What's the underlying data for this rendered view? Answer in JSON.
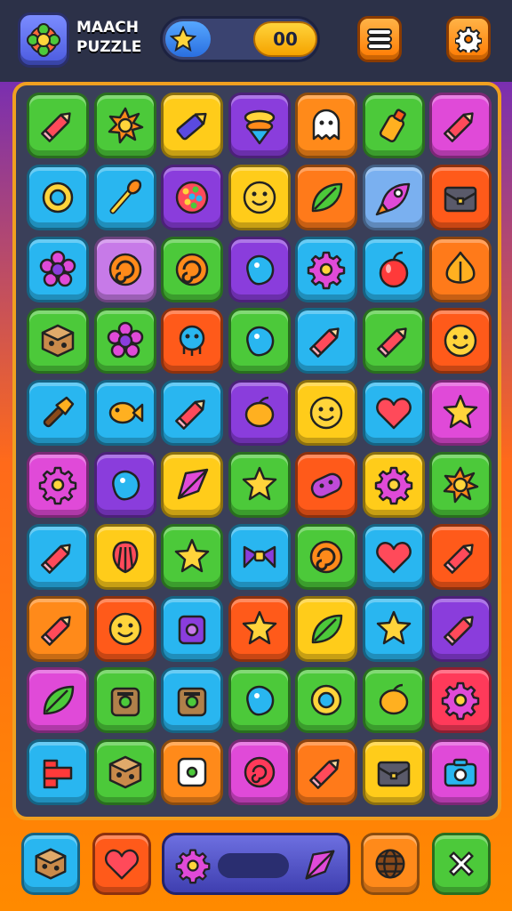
{
  "header": {
    "title_line1": "MAACH",
    "title_line2": "PUZZLE",
    "score": "00",
    "progress_fraction": 0.5
  },
  "board": {
    "columns": 7,
    "rows": 10,
    "tiles": [
      [
        {
          "color": "#4cc93a",
          "icon": "pencil-icon"
        },
        {
          "color": "#4cc93a",
          "icon": "sun-icon"
        },
        {
          "color": "#ffcc1a",
          "icon": "crayon-icon"
        },
        {
          "color": "#8a3ddc",
          "icon": "cone-icon"
        },
        {
          "color": "#ff8a1a",
          "icon": "ghost-icon"
        },
        {
          "color": "#4cc93a",
          "icon": "bottle-icon"
        },
        {
          "color": "#e04ad8",
          "icon": "pencil-icon"
        }
      ],
      [
        {
          "color": "#29b6f0",
          "icon": "ring-icon"
        },
        {
          "color": "#29b6f0",
          "icon": "wand-icon"
        },
        {
          "color": "#8a3ddc",
          "icon": "berry-icon"
        },
        {
          "color": "#ffcc1a",
          "icon": "smiley-icon"
        },
        {
          "color": "#ff7a1a",
          "icon": "leaf-icon"
        },
        {
          "color": "#7ab0f0",
          "icon": "rocket-icon"
        },
        {
          "color": "#ff5a1a",
          "icon": "chest-icon"
        }
      ],
      [
        {
          "color": "#29b6f0",
          "icon": "flower-icon"
        },
        {
          "color": "#c77ae8",
          "icon": "swirl-icon"
        },
        {
          "color": "#4cc93a",
          "icon": "swirl-icon"
        },
        {
          "color": "#8a3ddc",
          "icon": "blob-icon"
        },
        {
          "color": "#29b6f0",
          "icon": "gear-icon"
        },
        {
          "color": "#29b6f0",
          "icon": "cherry-icon"
        },
        {
          "color": "#ff7a1a",
          "icon": "onion-icon"
        }
      ],
      [
        {
          "color": "#4cc93a",
          "icon": "cube-icon"
        },
        {
          "color": "#4cc93a",
          "icon": "flower-icon"
        },
        {
          "color": "#ff5a1a",
          "icon": "critter-icon"
        },
        {
          "color": "#4cc93a",
          "icon": "blob-icon"
        },
        {
          "color": "#29b6f0",
          "icon": "pencil-icon"
        },
        {
          "color": "#4cc93a",
          "icon": "pencil-icon"
        },
        {
          "color": "#ff5a1a",
          "icon": "smiley-icon"
        }
      ],
      [
        {
          "color": "#29b6f0",
          "icon": "brush-icon"
        },
        {
          "color": "#29b6f0",
          "icon": "fish-icon"
        },
        {
          "color": "#29b6f0",
          "icon": "pencil-icon"
        },
        {
          "color": "#8a3ddc",
          "icon": "lemon-icon"
        },
        {
          "color": "#ffcc1a",
          "icon": "smiley-icon"
        },
        {
          "color": "#29b6f0",
          "icon": "heart-icon"
        },
        {
          "color": "#e04ad8",
          "icon": "star-icon"
        }
      ],
      [
        {
          "color": "#e04ad8",
          "icon": "gear-icon"
        },
        {
          "color": "#8a3ddc",
          "icon": "blob-icon"
        },
        {
          "color": "#ffcc1a",
          "icon": "kite-icon"
        },
        {
          "color": "#4cc93a",
          "icon": "star-icon"
        },
        {
          "color": "#ff5a1a",
          "icon": "capsule-icon"
        },
        {
          "color": "#ffcc1a",
          "icon": "gear-icon"
        },
        {
          "color": "#4cc93a",
          "icon": "sun-icon"
        }
      ],
      [
        {
          "color": "#29b6f0",
          "icon": "pencil-icon"
        },
        {
          "color": "#ffcc1a",
          "icon": "shell-icon"
        },
        {
          "color": "#4cc93a",
          "icon": "star-icon"
        },
        {
          "color": "#29b6f0",
          "icon": "bow-icon"
        },
        {
          "color": "#4cc93a",
          "icon": "swirl-icon"
        },
        {
          "color": "#29b6f0",
          "icon": "heart-icon"
        },
        {
          "color": "#ff5a1a",
          "icon": "pencil-icon"
        }
      ],
      [
        {
          "color": "#ff8a1a",
          "icon": "pencil-icon"
        },
        {
          "color": "#ff5a1a",
          "icon": "smiley-icon"
        },
        {
          "color": "#29b6f0",
          "icon": "box-icon"
        },
        {
          "color": "#ff5a1a",
          "icon": "star-icon"
        },
        {
          "color": "#ffcc1a",
          "icon": "leaf-icon"
        },
        {
          "color": "#29b6f0",
          "icon": "star-icon"
        },
        {
          "color": "#8a3ddc",
          "icon": "pencil-icon"
        }
      ],
      [
        {
          "color": "#e04ad8",
          "icon": "leaf-icon"
        },
        {
          "color": "#4cc93a",
          "icon": "radio-icon"
        },
        {
          "color": "#29b6f0",
          "icon": "radio-icon"
        },
        {
          "color": "#4cc93a",
          "icon": "blob-icon"
        },
        {
          "color": "#4cc93a",
          "icon": "ring-icon"
        },
        {
          "color": "#4cc93a",
          "icon": "lemon-icon"
        },
        {
          "color": "#ff3a5a",
          "icon": "gear-icon"
        }
      ],
      [
        {
          "color": "#29b6f0",
          "icon": "block-icon"
        },
        {
          "color": "#4cc93a",
          "icon": "cube-icon"
        },
        {
          "color": "#ff8a1a",
          "icon": "dice-icon"
        },
        {
          "color": "#e04ad8",
          "icon": "rose-icon"
        },
        {
          "color": "#ff7a1a",
          "icon": "pencil-icon"
        },
        {
          "color": "#ffcc1a",
          "icon": "chest-icon"
        },
        {
          "color": "#e04ad8",
          "icon": "camera-icon"
        }
      ]
    ]
  },
  "footer": {
    "left_button": {
      "color": "#29b6f0",
      "icon": "cube-icon"
    },
    "heart_button": {
      "color": "#ff5a1a",
      "icon": "heart-icon"
    },
    "booster": {
      "icon_left": "gear-icon",
      "icon_right": "kite-icon"
    },
    "globe_button": {
      "color": "#ff8a1a",
      "icon": "globe-icon"
    },
    "close_button": {
      "color": "#4cc93a",
      "icon": "close-icon"
    }
  }
}
